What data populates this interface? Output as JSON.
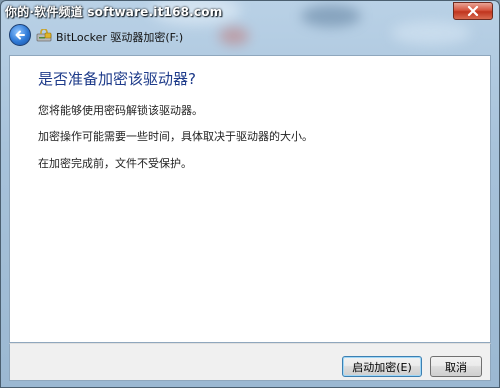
{
  "watermark": {
    "text": "你的·软件频道 software.it168.com"
  },
  "window": {
    "close_icon": "close-icon",
    "nav_title": "BitLocker 驱动器加密(F:)",
    "back_icon": "back-arrow-icon",
    "app_icon": "bitlocker-drive-icon"
  },
  "content": {
    "heading": "是否准备加密该驱动器?",
    "paragraphs": [
      "您将能够使用密码解锁该驱动器。",
      "加密操作可能需要一些时间，具体取决于驱动器的大小。",
      "在加密完成前，文件不受保护。"
    ]
  },
  "footer": {
    "start_label": "启动加密(E)",
    "cancel_label": "取消"
  },
  "colors": {
    "heading": "#1e3b8a",
    "frame": "#a7c2da",
    "close_button": "#c0351e"
  }
}
